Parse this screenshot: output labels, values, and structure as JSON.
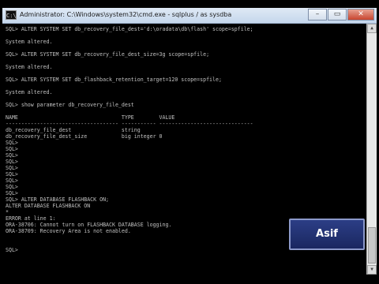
{
  "window": {
    "title": "Administrator: C:\\Windows\\system32\\cmd.exe - sqlplus  / as sysdba",
    "icon_label": "C:\\",
    "minimize_label": "–",
    "maximize_label": "▭",
    "close_label": "✕"
  },
  "console_lines": [
    "SQL> ALTER SYSTEM SET db_recovery_file_dest='d:\\oradata\\db\\flash' scope=spfile;",
    "",
    "System altered.",
    "",
    "SQL> ALTER SYSTEM SET db_recovery_file_dest_size=3g scope=spfile;",
    "",
    "System altered.",
    "",
    "SQL> ALTER SYSTEM SET db_flashback_retention_target=120 scope=spfile;",
    "",
    "System altered.",
    "",
    "SQL> show parameter db_recovery_file_dest",
    "",
    "NAME                                 TYPE        VALUE",
    "------------------------------------ ----------- ------------------------------",
    "db_recovery_file_dest                string",
    "db_recovery_file_dest_size           big integer 0",
    "SQL>",
    "SQL>",
    "SQL>",
    "SQL>",
    "SQL>",
    "SQL>",
    "SQL>",
    "SQL>",
    "SQL>",
    "SQL> ALTER DATABASE FLASHBACK ON;",
    "ALTER DATABASE FLASHBACK ON",
    "*",
    "ERROR at line 1:",
    "ORA-38706: Cannot turn on FLASHBACK DATABASE logging.",
    "ORA-38709: Recovery Area is not enabled.",
    "",
    "",
    "SQL>"
  ],
  "watermark": {
    "text": "Asif"
  },
  "scrollbar": {
    "up_label": "▲",
    "down_label": "▼"
  }
}
